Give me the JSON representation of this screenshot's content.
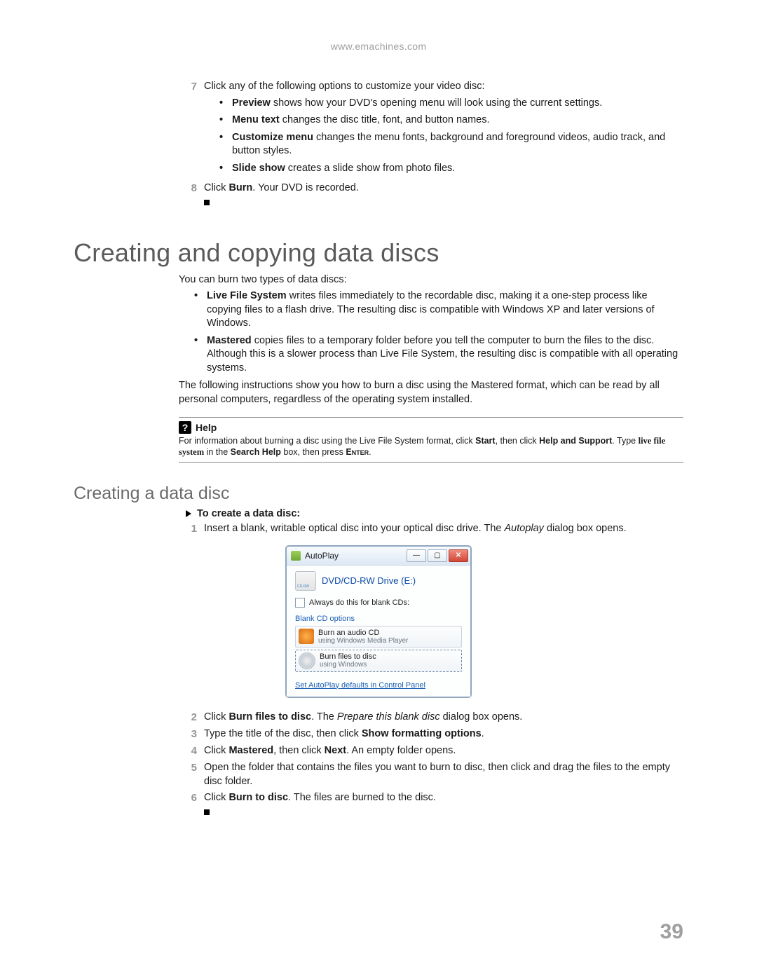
{
  "header_url": "www.emachines.com",
  "top_steps": {
    "seven": {
      "num": "7",
      "lead": "Click any of the following options to customize your video disc:",
      "bullets": [
        {
          "term": "Preview",
          "text": " shows how your DVD's opening menu will look using the current settings."
        },
        {
          "term": "Menu text",
          "text": " changes the disc title, font, and button names."
        },
        {
          "term": "Customize menu",
          "text": " changes the menu fonts, background and foreground videos, audio track, and button styles."
        },
        {
          "term": "Slide show",
          "text": " creates a slide show from photo files."
        }
      ]
    },
    "eight": {
      "num": "8",
      "pre": "Click ",
      "bold": "Burn",
      "post": ". Your DVD is recorded."
    }
  },
  "h1": "Creating and copying data discs",
  "intro1": "You can burn two types of data discs:",
  "intro_bullets": [
    {
      "term": "Live File System",
      "text": " writes files immediately to the recordable disc, making it a one-step process like copying files to a flash drive. The resulting disc is compatible with Windows XP and later versions of Windows."
    },
    {
      "term": "Mastered",
      "text": " copies files to a temporary folder before you tell the computer to burn the files to the disc. Although this is a slower process than Live File System, the resulting disc is compatible with all operating systems."
    }
  ],
  "intro2": "The following instructions show you how to burn a disc using the Mastered format, which can be read by all personal computers, regardless of the operating system installed.",
  "help": {
    "title": "Help",
    "p1": "For information about burning a disc using the Live File System format, click ",
    "b1": "Start",
    "p2": ", then click ",
    "b2": "Help and Support",
    "p3": ". Type ",
    "live": "live file system",
    "p4": " in the ",
    "b3": "Search Help",
    "p5": " box, then press ",
    "b4": "Enter",
    "p6": "."
  },
  "h2": "Creating a data disc",
  "proc_title": "To create a data disc:",
  "steps2": {
    "one": {
      "num": "1",
      "pre": "Insert a blank, writable optical disc into your optical disc drive. The ",
      "em": "Autoplay",
      "post": " dialog box opens."
    },
    "two": {
      "num": "2",
      "pre": "Click ",
      "b1": "Burn files to disc",
      "mid": ". The ",
      "em": "Prepare this blank disc",
      "post": " dialog box opens."
    },
    "three": {
      "num": "3",
      "pre": "Type the title of the disc, then click ",
      "b1": "Show formatting options",
      "post": "."
    },
    "four": {
      "num": "4",
      "pre": "Click ",
      "b1": "Mastered",
      "mid": ", then click ",
      "b2": "Next",
      "post": ". An empty folder opens."
    },
    "five": {
      "num": "5",
      "text": "Open the folder that contains the files you want to burn to disc, then click and drag the files to the empty disc folder."
    },
    "six": {
      "num": "6",
      "pre": "Click ",
      "b1": "Burn to disc",
      "post": ". The files are burned to the disc."
    }
  },
  "autoplay": {
    "title": "AutoPlay",
    "drive": "DVD/CD-RW Drive (E:)",
    "always": "Always do this for blank CDs:",
    "section": "Blank CD options",
    "opt1_title": "Burn an audio CD",
    "opt1_sub": "using Windows Media Player",
    "opt2_title": "Burn files to disc",
    "opt2_sub": "using Windows",
    "link": "Set AutoPlay defaults in Control Panel"
  },
  "page_num": "39"
}
